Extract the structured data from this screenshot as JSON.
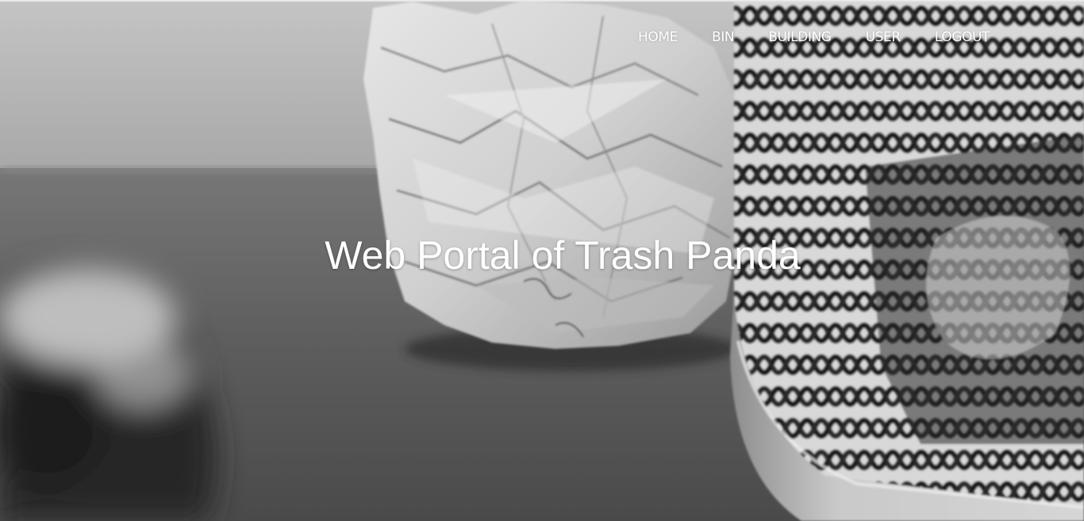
{
  "nav": {
    "items": [
      {
        "label": "HOME"
      },
      {
        "label": "BIN"
      },
      {
        "label": "BUILDING"
      },
      {
        "label": "USER"
      },
      {
        "label": "LOGOUT"
      }
    ]
  },
  "hero": {
    "title": "Web Portal of Trash Panda"
  },
  "colors": {
    "nav_text": "#ffffff",
    "title_text": "#ffffff"
  }
}
